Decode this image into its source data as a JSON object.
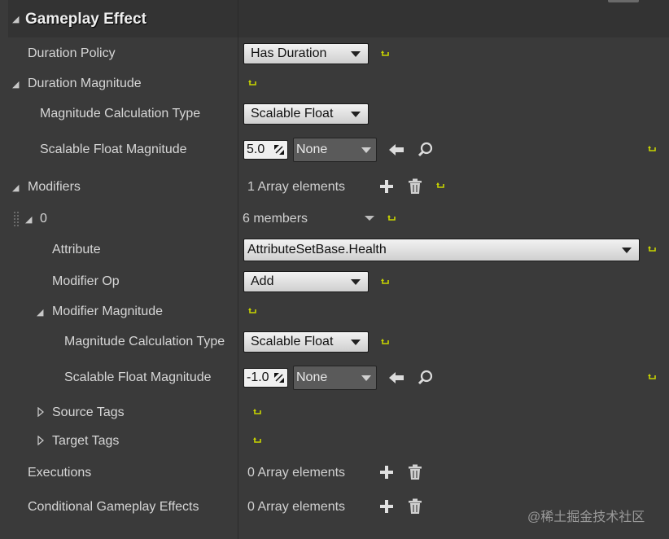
{
  "section": {
    "title": "Gameplay Effect"
  },
  "rows": {
    "duration_policy": {
      "label": "Duration Policy",
      "value": "Has Duration"
    },
    "duration_magnitude": {
      "label": "Duration Magnitude"
    },
    "dm_calc_type": {
      "label": "Magnitude Calculation Type",
      "value": "Scalable Float"
    },
    "dm_scalable": {
      "label": "Scalable Float Magnitude",
      "number": "5.0",
      "curve": "None"
    },
    "modifiers": {
      "label": "Modifiers",
      "count": "1 Array elements"
    },
    "modifier_0": {
      "label": "0",
      "members": "6 members"
    },
    "attribute": {
      "label": "Attribute",
      "value": "AttributeSetBase.Health"
    },
    "modifier_op": {
      "label": "Modifier Op",
      "value": "Add"
    },
    "modifier_magnitude": {
      "label": "Modifier Magnitude"
    },
    "mm_calc_type": {
      "label": "Magnitude Calculation Type",
      "value": "Scalable Float"
    },
    "mm_scalable": {
      "label": "Scalable Float Magnitude",
      "number": "-1.0",
      "curve": "None"
    },
    "source_tags": {
      "label": "Source Tags"
    },
    "target_tags": {
      "label": "Target Tags"
    },
    "executions": {
      "label": "Executions",
      "count": "0 Array elements"
    },
    "conditional": {
      "label": "Conditional Gameplay Effects",
      "count": "0 Array elements"
    }
  },
  "watermark": "@稀土掘金技术社区",
  "colors": {
    "reset_arrow": "#c8d400",
    "panel": "#3a3a3a",
    "header": "#333333"
  }
}
